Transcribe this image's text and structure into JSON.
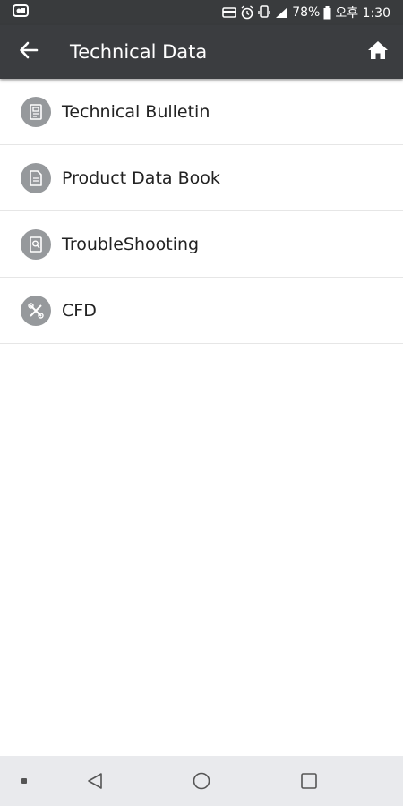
{
  "status_bar": {
    "battery": "78%",
    "time": "오후 1:30",
    "icons": [
      "app-notification-icon",
      "card-icon",
      "alarm-icon",
      "vibrate-icon",
      "signal-icon",
      "battery-icon"
    ]
  },
  "app_bar": {
    "title": "Technical Data",
    "back_icon": "arrow-left-icon",
    "home_icon": "home-icon"
  },
  "menu": {
    "items": [
      {
        "label": "Technical Bulletin",
        "icon": "bulletin-icon"
      },
      {
        "label": "Product Data Book",
        "icon": "document-icon"
      },
      {
        "label": "TroubleShooting",
        "icon": "troubleshooting-icon"
      },
      {
        "label": "CFD",
        "icon": "tools-icon"
      }
    ]
  },
  "nav_bar": {
    "icons": [
      "dot-icon",
      "nav-back-icon",
      "nav-home-icon",
      "nav-recent-icon"
    ]
  },
  "colors": {
    "status_bar": "#393b3d",
    "app_bar": "#3b3d40",
    "icon_circle": "#96999c",
    "nav_bar": "#e9eaed"
  }
}
